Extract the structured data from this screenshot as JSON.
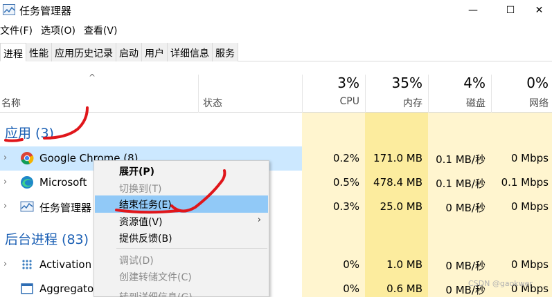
{
  "window": {
    "title": "任务管理器",
    "minimize_glyph": "—",
    "maximize_glyph": "☐",
    "close_glyph": "✕"
  },
  "menu": [
    "文件(F)",
    "选项(O)",
    "查看(V)"
  ],
  "tabs": [
    "进程",
    "性能",
    "应用历史记录",
    "启动",
    "用户",
    "详细信息",
    "服务"
  ],
  "active_tab": "进程",
  "columns": {
    "sort_indicator": "^",
    "name": "名称",
    "status": "状态",
    "cpu": {
      "percent": "3%",
      "label": "CPU"
    },
    "memory": {
      "percent": "35%",
      "label": "内存"
    },
    "disk": {
      "percent": "4%",
      "label": "磁盘"
    },
    "network": {
      "percent": "0%",
      "label": "网络"
    }
  },
  "groups": {
    "apps": "应用 (3)",
    "background": "后台进程 (83)"
  },
  "rows": [
    {
      "name": "Google Chrome (8)",
      "cpu": "0.2%",
      "memory": "171.0 MB",
      "disk": "0.1 MB/秒",
      "network": "0 Mbps",
      "icon": "chrome-icon"
    },
    {
      "name": "Microsoft",
      "cpu": "0.5%",
      "memory": "478.4 MB",
      "disk": "0.1 MB/秒",
      "network": "0.1 Mbps",
      "icon": "edge-icon"
    },
    {
      "name": "任务管理器",
      "cpu": "0.3%",
      "memory": "25.0 MB",
      "disk": "0 MB/秒",
      "network": "0 Mbps",
      "icon": "task-manager-icon"
    },
    {
      "name": "Activation",
      "cpu": "0%",
      "memory": "1.0 MB",
      "disk": "0 MB/秒",
      "network": "0 Mbps",
      "icon": "activation-icon"
    },
    {
      "name": "Aggregato",
      "cpu": "0%",
      "memory": "0.6 MB",
      "disk": "0 MB/秒",
      "network": "0 Mbps",
      "icon": "window-icon"
    }
  ],
  "context_menu": {
    "expand": "展开(P)",
    "switch_to": "切换到(T)",
    "end_task": "结束任务(E)",
    "resource_values": "资源值(V)",
    "submenu_arrow": "›",
    "feedback": "提供反馈(B)",
    "debug": "调试(D)",
    "create_dump": "创建转储文件(C)",
    "go_to_details": "转到详细信息(G)"
  },
  "colors": {
    "group_blue": "#1a5fb4",
    "selected_row": "#cce8ff",
    "menu_hover": "#91c9f7",
    "annotation_red": "#e0161b"
  },
  "watermark": "CSDN @gaokwer"
}
